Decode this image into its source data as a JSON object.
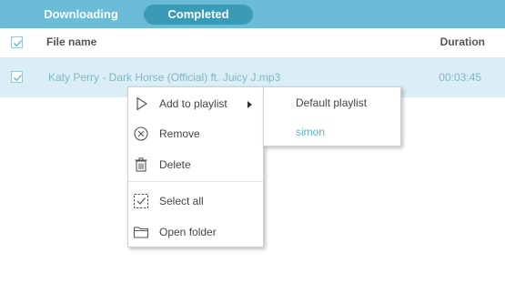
{
  "tabs": [
    {
      "label": "Downloading",
      "active": false
    },
    {
      "label": "Completed",
      "active": true
    }
  ],
  "header": {
    "filename_label": "File name",
    "duration_label": "Duration",
    "select_all_checked": true
  },
  "files": [
    {
      "name": "Katy Perry - Dark Horse (Official) ft. Juicy J.mp3",
      "duration": "00:03:45",
      "checked": true,
      "selected": true
    }
  ],
  "context_menu": {
    "items": [
      {
        "label": "Add to playlist",
        "icon": "play-outline-icon",
        "has_submenu": true
      },
      {
        "label": "Remove",
        "icon": "remove-circle-icon"
      },
      {
        "label": "Delete",
        "icon": "trash-icon"
      },
      {
        "label": "Select all",
        "icon": "select-all-icon"
      },
      {
        "label": "Open folder",
        "icon": "folder-icon"
      }
    ]
  },
  "playlist_submenu": {
    "items": [
      {
        "label": "Default playlist"
      },
      {
        "label": "simon"
      }
    ]
  },
  "colors": {
    "tabbar": "#6bbcd6",
    "active_tab": "#3a9bb6",
    "selected_row": "#dbeef5",
    "row_text": "#7fb6c4",
    "accent_text": "#5fb3c6"
  }
}
